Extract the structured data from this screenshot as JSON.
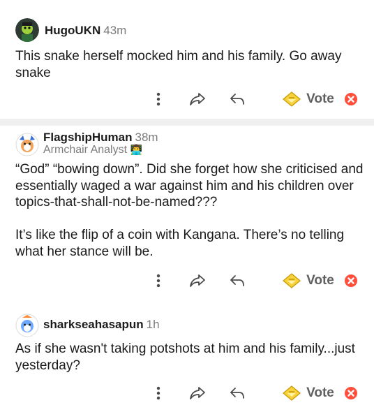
{
  "comments": [
    {
      "username": "HugoUKN",
      "age": "43m",
      "flair": "",
      "body": [
        "This snake herself mocked him and his family. Go away snake"
      ],
      "vote_label": "Vote"
    },
    {
      "username": "FlagshipHuman",
      "age": "38m",
      "flair": "Armchair Analyst",
      "flair_emoji": "👨‍💻",
      "body": [
        "“God” “bowing down”. Did she forget how she criticised and essentially waged a war against him and his children over topics-that-shall-not-be-named???",
        "It’s like the flip of a coin with Kangana. There’s no telling what her stance will be."
      ],
      "vote_label": "Vote"
    },
    {
      "username": "sharkseahasapun",
      "age": "1h",
      "flair": "",
      "body": [
        "As if she wasn't taking potshots at him and his family...just yesterday?"
      ],
      "vote_label": "Vote"
    }
  ],
  "icons": {
    "more": "more-vertical-icon",
    "share": "share-icon",
    "reply": "reply-icon",
    "award": "award-icon",
    "downvote": "downvote-icon"
  },
  "colors": {
    "award_gold": "#f2c21b",
    "downvote_red": "#ff4f3c",
    "divider": "#f0f0f0"
  }
}
